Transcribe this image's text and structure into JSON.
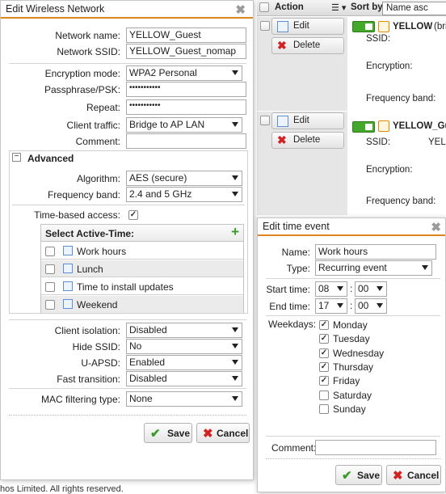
{
  "list_header": {
    "action_label": "Action",
    "sort_by_label": "Sort by:",
    "sort_value": "Name asc"
  },
  "list_rows": [
    {
      "edit_label": "Edit",
      "delete_label": "Delete",
      "name": "YELLOW",
      "name_suffix": "(bri",
      "ssid_label": "SSID:",
      "ssid_value": "",
      "encryption_label": "Encryption:",
      "frequency_label": "Frequency band:"
    },
    {
      "edit_label": "Edit",
      "delete_label": "Delete",
      "name": "YELLOW_Gu",
      "ssid_label": "SSID:",
      "ssid_value": "YEL",
      "encryption_label": "Encryption:",
      "frequency_label": "Frequency band:"
    }
  ],
  "edit_wireless": {
    "title": "Edit Wireless Network",
    "network_name_label": "Network name:",
    "network_name_value": "YELLOW_Guest",
    "network_ssid_label": "Network SSID:",
    "network_ssid_value": "YELLOW_Guest_nomap",
    "encryption_mode_label": "Encryption mode:",
    "encryption_mode_value": "WPA2 Personal",
    "passphrase_label": "Passphrase/PSK:",
    "passphrase_value": "•••••••••••",
    "repeat_label": "Repeat:",
    "repeat_value": "•••••••••••",
    "client_traffic_label": "Client traffic:",
    "client_traffic_value": "Bridge to AP LAN",
    "comment_label": "Comment:",
    "comment_value": "",
    "advanced_label": "Advanced",
    "algorithm_label": "Algorithm:",
    "algorithm_value": "AES (secure)",
    "frequency_band_label": "Frequency band:",
    "frequency_band_value": "2.4 and 5 GHz",
    "time_based_label": "Time-based access:",
    "time_based_checked": true,
    "active_time_title": "Select Active-Time:",
    "active_time_items": [
      "Work hours",
      "Lunch",
      "Time to install updates",
      "Weekend"
    ],
    "client_isolation_label": "Client isolation:",
    "client_isolation_value": "Disabled",
    "hide_ssid_label": "Hide SSID:",
    "hide_ssid_value": "No",
    "uapsd_label": "U-APSD:",
    "uapsd_value": "Enabled",
    "fast_transition_label": "Fast transition:",
    "fast_transition_value": "Disabled",
    "mac_filtering_label": "MAC filtering type:",
    "mac_filtering_value": "None",
    "save_label": "Save",
    "cancel_label": "Cancel"
  },
  "edit_time_event": {
    "title": "Edit time event",
    "name_label": "Name:",
    "name_value": "Work hours",
    "type_label": "Type:",
    "type_value": "Recurring event",
    "start_time_label": "Start time:",
    "start_hour": "08",
    "start_min": "00",
    "end_time_label": "End time:",
    "end_hour": "17",
    "end_min": "00",
    "time_sep": ":",
    "weekdays_label": "Weekdays:",
    "weekdays": [
      {
        "day": "Monday",
        "checked": true
      },
      {
        "day": "Tuesday",
        "checked": true
      },
      {
        "day": "Wednesday",
        "checked": true
      },
      {
        "day": "Thursday",
        "checked": true
      },
      {
        "day": "Friday",
        "checked": true
      },
      {
        "day": "Saturday",
        "checked": false
      },
      {
        "day": "Sunday",
        "checked": false
      }
    ],
    "comment_label": "Comment:",
    "comment_value": "",
    "save_label": "Save",
    "cancel_label": "Cancel"
  },
  "footer_text": "hos Limited. All rights reserved.",
  "colors": {
    "accent": "#e0861f",
    "save_green": "#3a9a27",
    "cancel_red": "#d22222",
    "toggle_green": "#45a82c"
  }
}
